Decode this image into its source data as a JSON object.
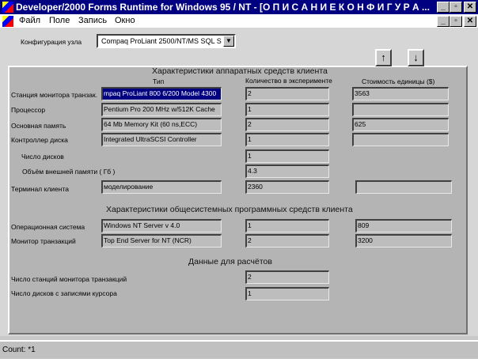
{
  "window": {
    "title": "Developer/2000 Forms Runtime for Windows 95 / NT - [О П И С А Н И Е    К О Н Ф И Г У Р А ...",
    "minimize": "_",
    "restore": "▫",
    "close": "✕"
  },
  "menu": [
    {
      "label": "Файл"
    },
    {
      "label": "Поле"
    },
    {
      "label": "Запись"
    },
    {
      "label": "Окно"
    }
  ],
  "config": {
    "label": "Конфигурация узла",
    "value": "Compaq ProLiant 2500/NT/MS SQL S"
  },
  "nav": {
    "up": "↑",
    "down": "↓"
  },
  "hardware": {
    "title": "Характеристики аппаратных средств клиента",
    "col_type": "Тип",
    "col_qty": "Количество в эксперименте",
    "col_cost": "Стоимость единицы ($)",
    "rows": [
      {
        "label": "Станция монитора транзак.",
        "type": "mpaq ProLiant 800 6/200 Model 4300",
        "qty": "2",
        "cost": "3563"
      },
      {
        "label": "Процессор",
        "type": "Pentium Pro 200 MHz w/512K Cache",
        "qty": "1",
        "cost": ""
      },
      {
        "label": "Основная память",
        "type": "64 Mb Memory Kit (60 ns,ECC)",
        "qty": "2",
        "cost": "625"
      },
      {
        "label": "Контроллер диска",
        "type": "Integrated UltraSCSI Controller",
        "qty": "1",
        "cost": ""
      }
    ],
    "disks_label": "Число дисков",
    "disks": "1",
    "storage_label": "Объём внешней памяти ( Гб )",
    "storage": "4.3",
    "terminal": {
      "label": "Терминал клиента",
      "type": "моделирование",
      "qty": "2360",
      "cost": ""
    }
  },
  "software": {
    "title": "Характеристики общесистемных программных средств клиента",
    "rows": [
      {
        "label": "Операционная система",
        "type": "Windows NT Server v 4.0",
        "qty": "1",
        "cost": "809"
      },
      {
        "label": "Монитор транзакций",
        "type": "Top End Server for NT (NCR)",
        "qty": "2",
        "cost": "3200"
      }
    ]
  },
  "calc": {
    "title": "Данные для расчётов",
    "rows": [
      {
        "label": "Число станций монитора транзакций",
        "value": "2"
      },
      {
        "label": "Число дисков с записями курсора",
        "value": "1"
      }
    ]
  },
  "status": "Count: *1"
}
